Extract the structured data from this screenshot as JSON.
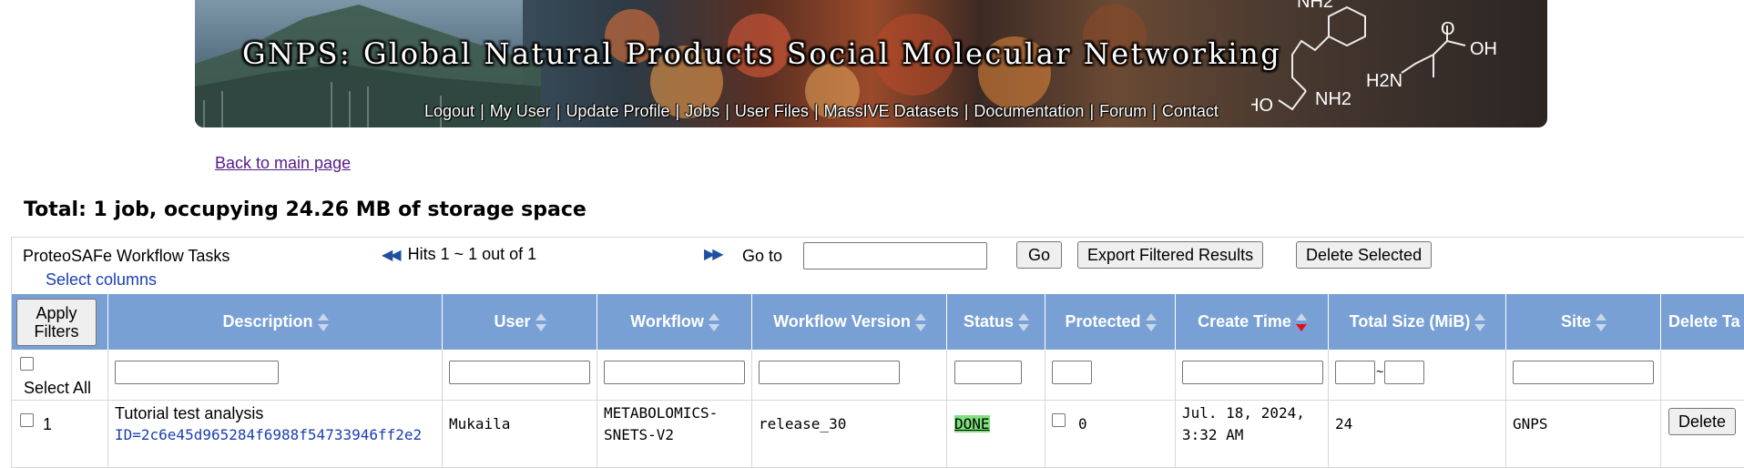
{
  "banner": {
    "title": "GNPS: Global Natural Products Social Molecular Networking",
    "nav": [
      "Logout",
      "My User",
      "Update Profile",
      "Jobs",
      "User Files",
      "MassIVE Datasets",
      "Documentation",
      "Forum",
      "Contact"
    ],
    "chem_labels": [
      "NH2",
      "O",
      "OH",
      "H2N",
      "NH2",
      "HO"
    ]
  },
  "back_link": "Back to main page",
  "total_text": "Total: 1 job, occupying 24.26 MB of storage space",
  "panel": {
    "title": "ProteoSAFe Workflow Tasks",
    "select_columns": "Select columns",
    "hits": "Hits 1 ~ 1 out of 1",
    "goto_label": "Go to",
    "go_button": "Go",
    "export_button": "Export Filtered Results",
    "delete_selected_button": "Delete Selected"
  },
  "table": {
    "apply_filters": "Apply Filters",
    "columns": [
      "Description",
      "User",
      "Workflow",
      "Workflow Version",
      "Status",
      "Protected",
      "Create Time",
      "Total Size (MiB)",
      "Site",
      "Delete Ta"
    ],
    "select_all": "Select All",
    "size_range_sep": "~",
    "rows": [
      {
        "index": "1",
        "description": "Tutorial test analysis",
        "id": "ID=2c6e45d965284f6988f54733946ff2e2",
        "user": "Mukaila",
        "workflow_line1": "METABOLOMICS-",
        "workflow_line2": "SNETS-V2",
        "version": "release_30",
        "status": "DONE",
        "protected_count": "0",
        "create_time_line1": "Jul. 18, 2024,",
        "create_time_line2": "3:32 AM",
        "size": "24",
        "site": "GNPS",
        "delete": "Delete"
      }
    ]
  }
}
